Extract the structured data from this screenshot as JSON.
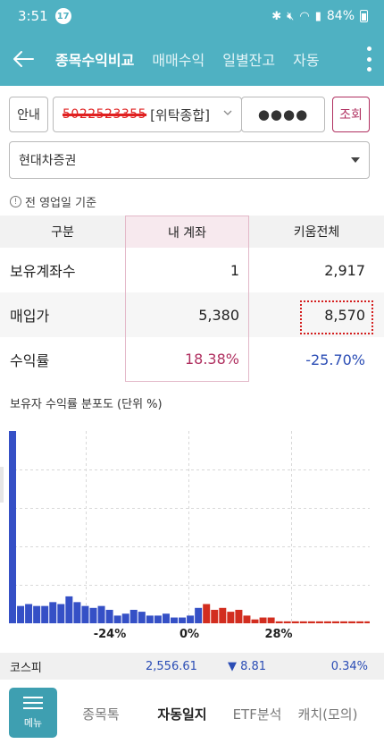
{
  "status_bar": {
    "time": "3:51",
    "notification_count": "17",
    "battery": "84%"
  },
  "header": {
    "tabs": [
      "종목수익비교",
      "매매수익",
      "일별잔고",
      "자동"
    ],
    "active_tab": 0
  },
  "account": {
    "guide_label": "안내",
    "account_number": "5022523355",
    "account_type": "[위탁종합]",
    "password_mask": "●●●●",
    "query_label": "조회"
  },
  "broker": {
    "selected": "현대차증권"
  },
  "note": "전 영업일 기준",
  "table": {
    "headers": [
      "구분",
      "내 계좌",
      "키움전체"
    ],
    "rows": [
      {
        "label": "보유계좌수",
        "mine": "1",
        "all": "2,917"
      },
      {
        "label": "매입가",
        "mine": "5,380",
        "all": "8,570"
      },
      {
        "label": "수익률",
        "mine": "18.38%",
        "all": "-25.70%"
      }
    ]
  },
  "section_title": "보유자 수익률 분포도 (단위 %)",
  "chart_data": {
    "type": "bar",
    "x_tick_labels": [
      "-24%",
      "0%",
      "28%"
    ],
    "bins_negative": [
      100,
      9,
      10,
      9,
      9,
      11,
      10,
      14,
      11,
      9,
      8,
      9,
      7,
      4,
      5,
      7,
      6,
      4,
      4,
      5,
      3,
      3,
      4
    ],
    "bins_zero": [
      8
    ],
    "bins_positive": [
      10,
      7,
      8,
      6,
      7,
      4,
      2,
      3,
      3,
      1,
      1,
      1,
      1,
      1,
      1,
      1,
      1,
      1,
      1,
      1,
      1,
      1,
      1,
      1,
      1,
      1
    ],
    "colors": {
      "negative": "#3550c6",
      "zero": "#3550c6",
      "positive": "#d22d1f",
      "grid": "#d8d8d8"
    },
    "grid": true,
    "ylim": [
      0,
      100
    ]
  },
  "ticker": {
    "name": "코스피",
    "value": "2,556.61",
    "change": "▼ 8.81",
    "percent": "0.34%"
  },
  "bottom_nav": {
    "menu_label": "메뉴",
    "items": [
      "종목톡",
      "자동일지",
      "ETF분석",
      "캐치(모의)"
    ],
    "active_index": 1
  }
}
